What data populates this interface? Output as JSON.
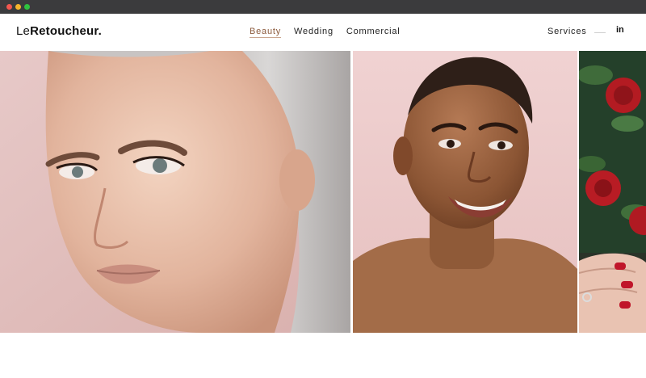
{
  "logo": {
    "prefix": "Le",
    "name": "Retoucheur."
  },
  "nav": {
    "items": [
      {
        "label": "Beauty",
        "active": true
      },
      {
        "label": "Wedding",
        "active": false
      },
      {
        "label": "Commercial",
        "active": false
      }
    ]
  },
  "header_right": {
    "services": "Services",
    "social": "in"
  },
  "colors": {
    "chrome": "#3b3b3d",
    "accent": "#8b5a3c",
    "background": "#ffffff"
  },
  "gallery": {
    "images": [
      {
        "name": "portrait-blonde-woman"
      },
      {
        "name": "portrait-smiling-woman"
      },
      {
        "name": "roses-and-red-nails"
      }
    ]
  }
}
